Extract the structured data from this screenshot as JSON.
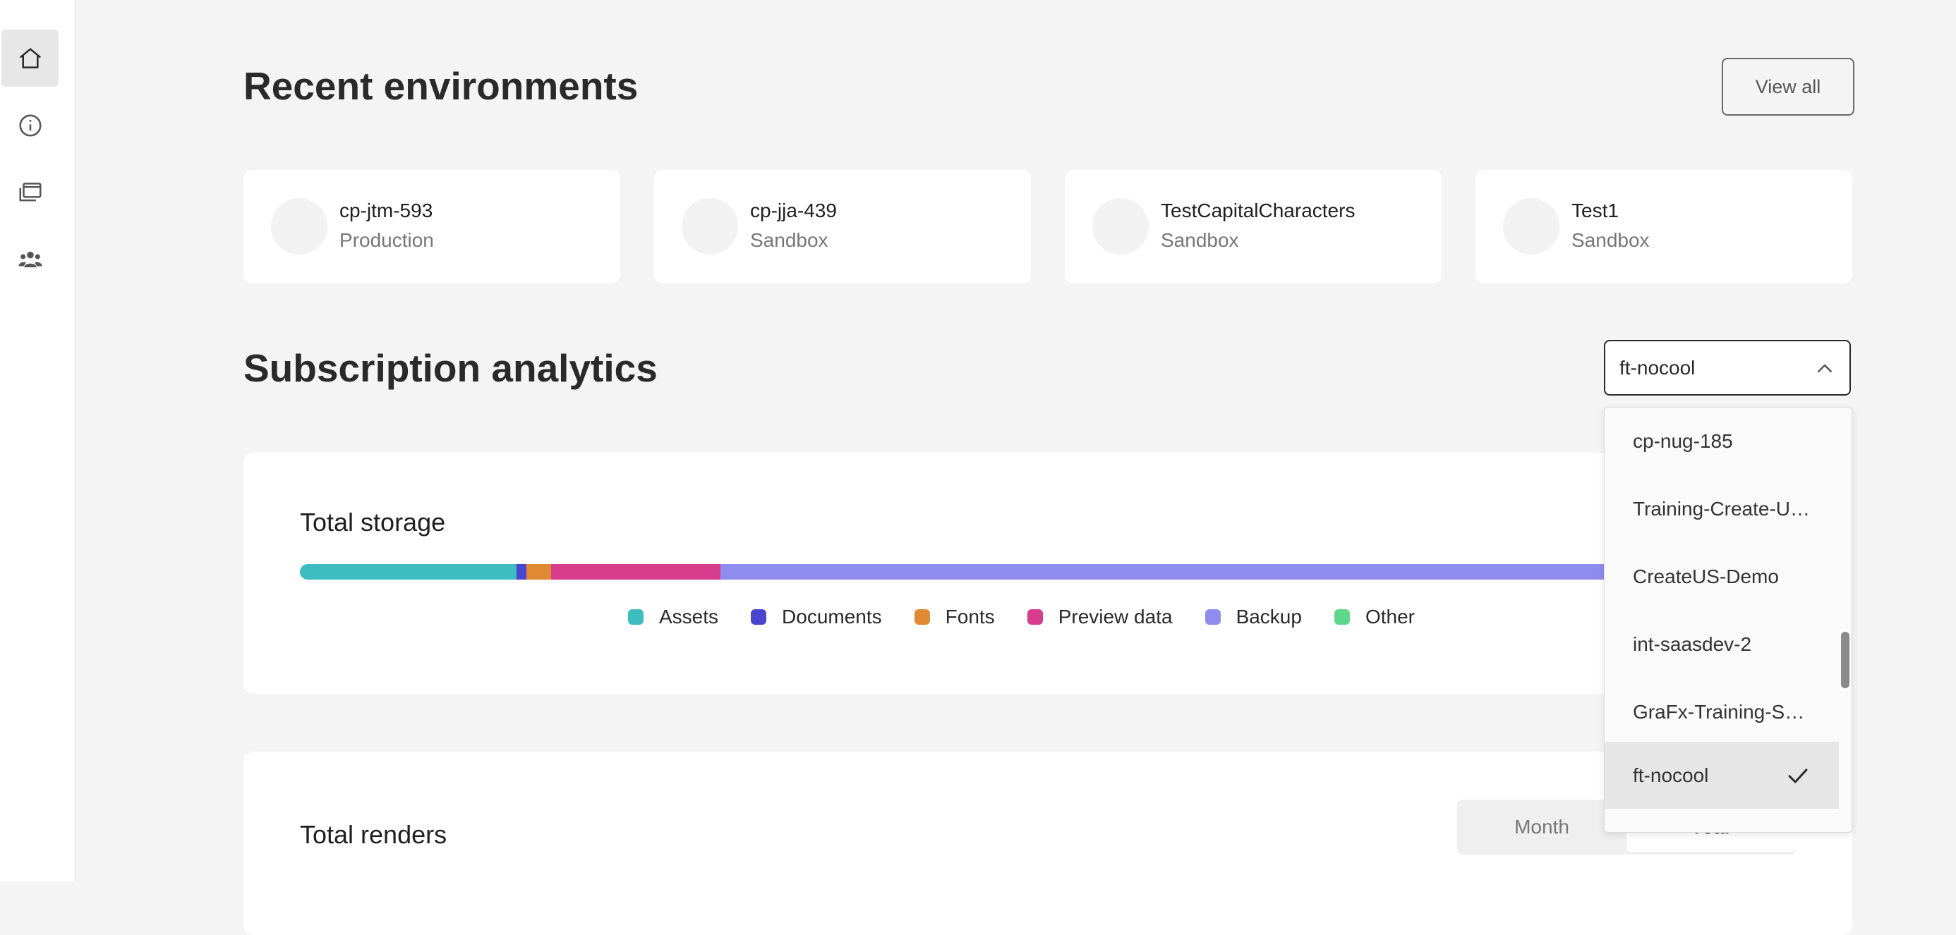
{
  "sidebar": {
    "items": [
      {
        "icon": "home-icon",
        "active": true
      },
      {
        "icon": "info-icon",
        "active": false
      },
      {
        "icon": "environments-icon",
        "active": false
      },
      {
        "icon": "users-icon",
        "active": false
      }
    ]
  },
  "recent": {
    "title": "Recent environments",
    "view_all": "View all",
    "environments": [
      {
        "name": "cp-jtm-593",
        "type": "Production"
      },
      {
        "name": "cp-jja-439",
        "type": "Sandbox"
      },
      {
        "name": "TestCapitalCharacters",
        "type": "Sandbox"
      },
      {
        "name": "Test1",
        "type": "Sandbox"
      }
    ]
  },
  "analytics": {
    "title": "Subscription analytics",
    "selected_environment": "ft-nocool",
    "dropdown_options": [
      {
        "label": "cp-nug-185",
        "selected": false
      },
      {
        "label": "Training-Create-US…",
        "selected": false
      },
      {
        "label": "CreateUS-Demo",
        "selected": false
      },
      {
        "label": "int-saasdev-2",
        "selected": false
      },
      {
        "label": "GraFx-Training-ST…",
        "selected": false
      },
      {
        "label": "ft-nocool",
        "selected": true
      }
    ]
  },
  "storage": {
    "title": "Total storage",
    "segments": [
      {
        "name": "Assets",
        "color": "#3dbdbf",
        "fraction": 0.155
      },
      {
        "name": "Documents",
        "color": "#4a45cf",
        "fraction": 0.007
      },
      {
        "name": "Fonts",
        "color": "#e08a34",
        "fraction": 0.018
      },
      {
        "name": "Preview data",
        "color": "#d83c8d",
        "fraction": 0.121
      },
      {
        "name": "Backup",
        "color": "#8f8cf0",
        "fraction": 0.699
      },
      {
        "name": "Other",
        "color": "#5dd88a",
        "fraction": 0.0
      }
    ]
  },
  "renders": {
    "title": "Total renders",
    "period_options": [
      "Month",
      "Year"
    ],
    "active_period": "Year"
  }
}
